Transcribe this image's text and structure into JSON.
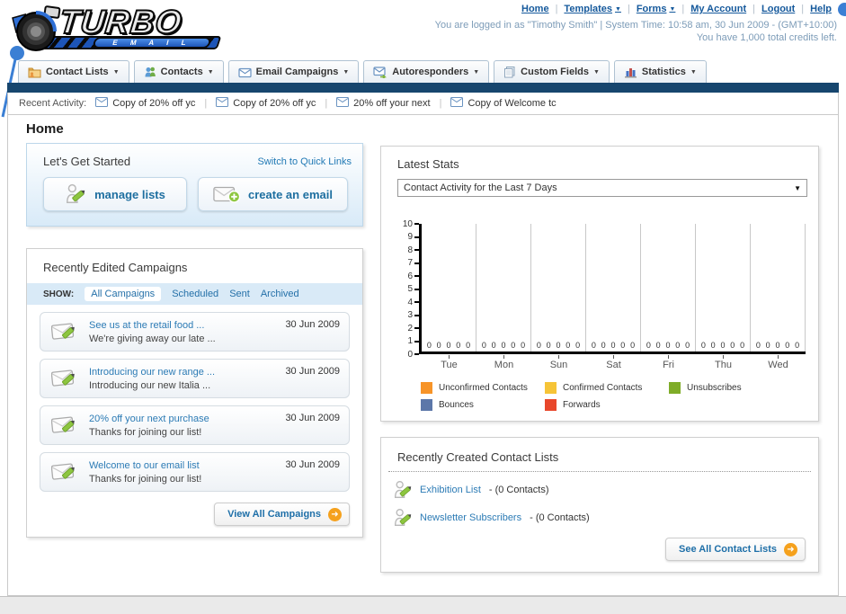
{
  "header": {
    "logo_title": "TURBO",
    "logo_subtitle": "E M A I L",
    "links": [
      {
        "label": "Home",
        "dropdown": false
      },
      {
        "label": "Templates",
        "dropdown": true
      },
      {
        "label": "Forms",
        "dropdown": true
      },
      {
        "label": "My Account",
        "dropdown": false
      },
      {
        "label": "Logout",
        "dropdown": false
      },
      {
        "label": "Help",
        "dropdown": false
      }
    ],
    "login_line": "You are logged in as \"Timothy Smith\" | System Time: 10:58 am, 30 Jun 2009 - (GMT+10:00)",
    "credits_line": "You have 1,000 total credits left."
  },
  "nav": {
    "tabs": [
      {
        "label": "Contact Lists",
        "icon": "folder-contacts-icon"
      },
      {
        "label": "Contacts",
        "icon": "people-icon"
      },
      {
        "label": "Email Campaigns",
        "icon": "envelope-icon"
      },
      {
        "label": "Autoresponders",
        "icon": "envelope-reply-icon"
      },
      {
        "label": "Custom Fields",
        "icon": "pages-icon"
      },
      {
        "label": "Statistics",
        "icon": "bar-chart-icon"
      }
    ]
  },
  "recent_activity": {
    "label": "Recent Activity:",
    "items": [
      "Copy of 20% off yc",
      "Copy of 20% off yc",
      "20% off your next",
      "Copy of Welcome tc"
    ]
  },
  "page": {
    "title": "Home"
  },
  "get_started": {
    "title": "Let's Get Started",
    "switch_link": "Switch to Quick Links",
    "manage_lists_label": "manage lists",
    "create_email_label": "create an email"
  },
  "campaigns": {
    "title": "Recently Edited Campaigns",
    "show_label": "SHOW:",
    "filters": [
      {
        "label": "All Campaigns",
        "active": true
      },
      {
        "label": "Scheduled",
        "active": false
      },
      {
        "label": "Sent",
        "active": false
      },
      {
        "label": "Archived",
        "active": false
      }
    ],
    "items": [
      {
        "title": "See us at the retail food ...",
        "subtitle": "We're giving away our late ...",
        "date": "30 Jun 2009"
      },
      {
        "title": "Introducing our new range ...",
        "subtitle": "Introducing our new Italia ...",
        "date": "30 Jun 2009"
      },
      {
        "title": "20% off your next purchase",
        "subtitle": "Thanks for joining our list!",
        "date": "30 Jun 2009"
      },
      {
        "title": "Welcome to our email list",
        "subtitle": "Thanks for joining our list!",
        "date": "30 Jun 2009"
      }
    ],
    "view_all_label": "View All Campaigns"
  },
  "stats": {
    "title": "Latest Stats",
    "dropdown_value": "Contact Activity for the Last 7 Days"
  },
  "chart_data": {
    "type": "bar",
    "title": "Contact Activity for the Last 7 Days",
    "categories": [
      "Tue",
      "Mon",
      "Sun",
      "Sat",
      "Fri",
      "Thu",
      "Wed"
    ],
    "series": [
      {
        "name": "Unconfirmed Contacts",
        "color": "#F79428",
        "values": [
          0,
          0,
          0,
          0,
          0,
          0,
          0
        ]
      },
      {
        "name": "Confirmed Contacts",
        "color": "#F6C437",
        "values": [
          0,
          0,
          0,
          0,
          0,
          0,
          0
        ]
      },
      {
        "name": "Unsubscribes",
        "color": "#7FAC28",
        "values": [
          0,
          0,
          0,
          0,
          0,
          0,
          0
        ]
      },
      {
        "name": "Bounces",
        "color": "#5C77A9",
        "values": [
          0,
          0,
          0,
          0,
          0,
          0,
          0
        ]
      },
      {
        "name": "Forwards",
        "color": "#E8472B",
        "values": [
          0,
          0,
          0,
          0,
          0,
          0,
          0
        ]
      }
    ],
    "ylim": [
      0,
      10
    ],
    "yticks": [
      10,
      9,
      8,
      7,
      6,
      5,
      4,
      3,
      2,
      1,
      0
    ],
    "grid": true,
    "legend_position": "bottom"
  },
  "contact_lists": {
    "title": "Recently Created Contact Lists",
    "items": [
      {
        "name": "Exhibition List",
        "meta": "- (0 Contacts)"
      },
      {
        "name": "Newsletter Subscribers",
        "meta": "- (0 Contacts)"
      }
    ],
    "see_all_label": "See All Contact Lists"
  },
  "colors": {
    "navy_bar": "#17466E",
    "link_blue": "#1E6FA8",
    "header_link_blue": "#15599C",
    "button_arrow_orange": "#F5A11D",
    "pencil_green": "#8DC63F",
    "show_bar_bg": "#D9EAF7"
  }
}
